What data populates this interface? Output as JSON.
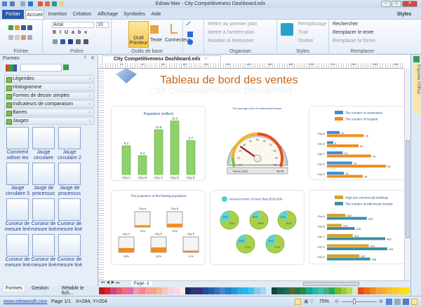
{
  "window": {
    "title": "Edraw Max - City Competitiveness Dashboard.edx",
    "styles_label": "Styles"
  },
  "tabs": [
    "Fichier",
    "Accueil",
    "Insertion",
    "Création",
    "Affichage",
    "Symboles",
    "Aide"
  ],
  "ribbon": {
    "groups": [
      "Fichier",
      "Police",
      "Outils de base",
      "Organiser",
      "Styles",
      "Remplacer"
    ],
    "font_name": "Arial",
    "font_size": "10",
    "outil_pointeur": "Outil Pointeur",
    "texte": "Texte",
    "connecteur": "Connecteur",
    "organiser": [
      "Mettre au premier plan",
      "Mettre à l'arrière-plan",
      "Rotation & Retourner"
    ],
    "styles": [
      "Remplissage",
      "Trait",
      "Ombre"
    ],
    "remplacer": [
      "Rechercher",
      "Remplacer le texte",
      "Remplacer la forme"
    ]
  },
  "left_panel": {
    "title": "Formes",
    "categories": [
      "Légendes",
      "Histogramme",
      "Formes de dessin simples",
      "Indicateurs de comparaison",
      "Barres",
      "Jauges"
    ],
    "shapes": [
      "Comment utiliser les",
      "Jauge circulaire",
      "Jauge circulaire 2",
      "Jauge circulaire 3",
      "Jauge de processus",
      "Jauge de processus",
      "Curseur de mesure liné",
      "Curseur de mesure liné",
      "Curseur de mesure liné",
      "Curseur de mesure liné",
      "Curseur de mesure liné",
      "Curseur de mesure liné"
    ],
    "bottom_tabs": [
      "Formes",
      "Gestion",
      "Rétablir le fich..."
    ]
  },
  "document": {
    "tab": "City Competitiveness Dashboard.edx",
    "title": "Tableau de bord des ventes",
    "reflection": "City Competitiveness Dashboard",
    "page_tab": "Page-1",
    "right_strip": "Exporter l'Office",
    "ruler": [
      "20",
      "40",
      "60",
      "80",
      "100",
      "120",
      "140",
      "160",
      "180",
      "200",
      "220",
      "240",
      "260",
      "280"
    ]
  },
  "chart_data": [
    {
      "type": "bar",
      "title": "Population (million)",
      "categories": [
        "City A",
        "City B",
        "City C",
        "City D",
        "City E"
      ],
      "values": [
        8.2,
        5.4,
        12.8,
        15.3,
        9.7
      ],
      "ylim": [
        0,
        16
      ],
      "color": "#8fd16a"
    },
    {
      "type": "gauge",
      "title": "The average price of commercial house",
      "ticks": [
        "100",
        "1K",
        "2K",
        "3K",
        "4K",
        "5K",
        "6K",
        "7K",
        "8K",
        "9K",
        "10K"
      ],
      "value": 2.5,
      "range": [
        0,
        10
      ],
      "readout_label": "House price",
      "readout_value": "$2.5K"
    },
    {
      "type": "bar",
      "orientation": "horizontal",
      "categories": [
        "City A",
        "City B",
        "City C",
        "City D",
        "City E"
      ],
      "series": [
        {
          "name": "The number of universities",
          "values": [
            12,
            6,
            15,
            24,
            16
          ],
          "color": "#3b8de0"
        },
        {
          "name": "The number of hospital",
          "values": [
            35,
            30,
            42,
            56,
            34
          ],
          "color": "#f28c1e"
        }
      ],
      "xlim": [
        0,
        60
      ]
    },
    {
      "type": "waffle",
      "title": "The proportion of the floating population",
      "categories": [
        "City A",
        "City B",
        "City C",
        "City D",
        "City E"
      ],
      "labels": [
        "12%",
        "22%",
        "28%",
        "32%",
        "11%"
      ],
      "values": [
        12,
        22,
        28,
        32,
        11
      ]
    },
    {
      "type": "pie",
      "title": "Annual income of more than $100,000",
      "slices": [
        {
          "a": "28%",
          "b": "72%",
          "v": 28
        },
        {
          "a": "16%",
          "b": "84%",
          "v": 16
        },
        {
          "a": "19%",
          "b": "81%",
          "v": 19
        },
        {
          "a": "23%",
          "b": "77%",
          "v": 23
        },
        {
          "a": "29%",
          "b": "71%",
          "v": 29
        }
      ]
    },
    {
      "type": "bar",
      "orientation": "horizontal",
      "categories": [
        "City A",
        "City B",
        "City C",
        "City D",
        "City E"
      ],
      "series": [
        {
          "name": "High-rise commercial buildings",
          "values": [
            152,
            120,
            212,
            344,
            267
          ],
          "color": "#d4a12a"
        },
        {
          "name": "The number of well-known brands",
          "values": [
            328,
            228,
            480,
            496,
            356
          ],
          "color": "#3a8fa3"
        }
      ],
      "xlim": [
        0,
        520
      ]
    }
  ],
  "palette": [
    "#c0161c",
    "#e0202a",
    "#d1487a",
    "#e85a6a",
    "#ee6f80",
    "#e56aa0",
    "#f29bb0",
    "#f4888a",
    "#f7a0a8",
    "#f9a57a",
    "#f6b49a",
    "#f8c4bc",
    "#ecd6e4",
    "#fbd9e4",
    "#fce8ee",
    "#1a2a5a",
    "#253c7a",
    "#3a2f7a",
    "#1f4f99",
    "#1e63a8",
    "#3d6dbb",
    "#4b86c9",
    "#1f86d0",
    "#2596d8",
    "#36a8e0",
    "#25b8ef",
    "#3cc6f5",
    "#8cc8ec",
    "#a6d6f0",
    "#d2eaf6",
    "#0f4a36",
    "#1a5f4a",
    "#1b6b5f",
    "#5b6a2a",
    "#1f7a3f",
    "#2a8a3a",
    "#12a88a",
    "#2ab5a5",
    "#3cc4a8",
    "#48b080",
    "#1fae5a",
    "#7ab82a",
    "#a0c840",
    "#c0d850",
    "#d0ecd0",
    "#e84a20",
    "#ee6a10",
    "#f08a1a",
    "#f4a040",
    "#f6b020",
    "#f8c030",
    "#fbcc30",
    "#fdd820",
    "#ffe600"
  ],
  "status": {
    "link": "www.edrawsoft.com",
    "page": "Page 1/1",
    "coords": "X=284, Y=204",
    "zoom": "75%"
  }
}
